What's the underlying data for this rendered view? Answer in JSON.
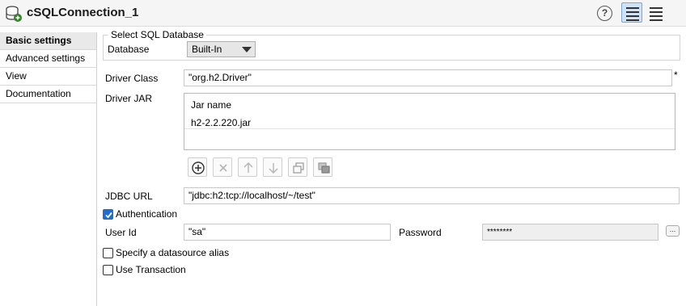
{
  "header": {
    "title": "cSQLConnection_1",
    "help_glyph": "?",
    "icons": [
      "database-icon",
      "help-icon",
      "table-view-icon",
      "list-view-icon"
    ]
  },
  "sidebar": {
    "items": [
      {
        "label": "Basic settings",
        "active": true
      },
      {
        "label": "Advanced settings",
        "active": false
      },
      {
        "label": "View",
        "active": false
      },
      {
        "label": "Documentation",
        "active": false
      }
    ]
  },
  "select_db": {
    "legend": "Select SQL Database",
    "database_label": "Database",
    "database_value": "Built-In"
  },
  "driver": {
    "class_label": "Driver Class",
    "class_value": "\"org.h2.Driver\"",
    "required_mark": "*",
    "jar_label": "Driver JAR",
    "jar_table": {
      "header": "Jar name",
      "rows": [
        "h2-2.2.220.jar"
      ]
    },
    "toolbar_icons": [
      "add-icon",
      "remove-icon",
      "move-up-icon",
      "move-down-icon",
      "copy-icon",
      "paste-icon"
    ]
  },
  "jdbc": {
    "label": "JDBC URL",
    "value": "\"jdbc:h2:tcp://localhost/~/test\""
  },
  "auth": {
    "checkbox_label": "Authentication",
    "checked": true,
    "user_label": "User Id",
    "user_value": "\"sa\"",
    "password_label": "Password",
    "password_value": "********",
    "more_button": "..."
  },
  "options": {
    "datasource_alias_label": "Specify a datasource alias",
    "datasource_alias_checked": false,
    "use_transaction_label": "Use Transaction",
    "use_transaction_checked": false
  },
  "colors": {
    "accent": "#1f6fd1",
    "active_view_bg": "#cfe3f8"
  }
}
